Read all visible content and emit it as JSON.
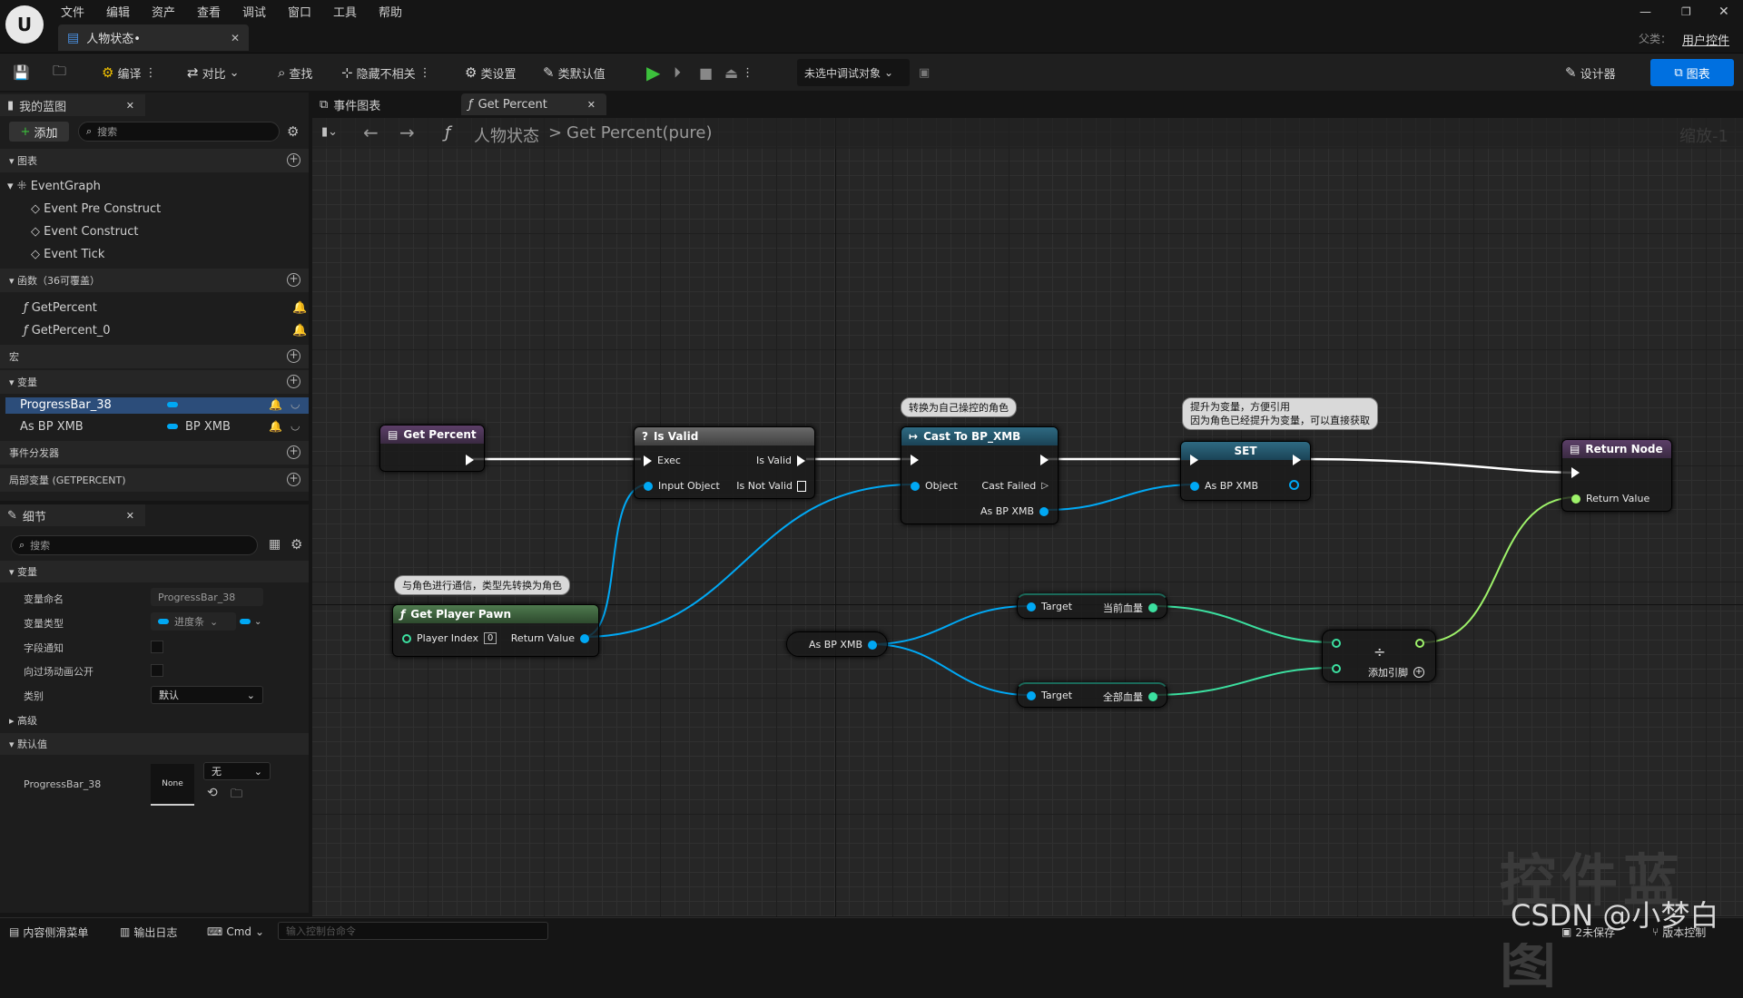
{
  "window": {
    "tab_title": "人物状态•",
    "parent_label": "父类：",
    "parent_value": "用户控件"
  },
  "menu": [
    "文件",
    "编辑",
    "资产",
    "查看",
    "调试",
    "窗口",
    "工具",
    "帮助"
  ],
  "toolbar": {
    "compile": "编译",
    "diff": "对比",
    "find": "查找",
    "hide_unrelated": "隐藏不相关",
    "class_settings": "类设置",
    "class_defaults": "类默认值",
    "debug_target": "未选中调试对象",
    "designer": "设计器",
    "graph": "图表"
  },
  "my_blueprint": {
    "tab": "我的蓝图",
    "add": "添加",
    "search_placeholder": "搜索",
    "graphs_header": "图表",
    "event_graph": "EventGraph",
    "events": [
      "Event Pre Construct",
      "Event Construct",
      "Event Tick"
    ],
    "functions_header": "函数（36可覆盖）",
    "functions": [
      "GetPercent",
      "GetPercent_0"
    ],
    "macros_header": "宏",
    "variables_header": "变量",
    "variables": [
      {
        "name": "ProgressBar_38",
        "type": ""
      },
      {
        "name": "As BP XMB",
        "type": "BP XMB"
      }
    ],
    "dispatchers_header": "事件分发器",
    "locals_header": "局部变量 (GETPERCENT)"
  },
  "details": {
    "tab": "细节",
    "search_placeholder": "搜索",
    "section_variable": "变量",
    "var_name_label": "变量命名",
    "var_name_value": "ProgressBar_38",
    "var_type_label": "变量类型",
    "var_type_value": "进度条",
    "field_notify_label": "字段通知",
    "expose_anim_label": "向过场动画公开",
    "category_label": "类别",
    "category_value": "默认",
    "advanced": "高级",
    "defaults_header": "默认值",
    "default_var": "ProgressBar_38",
    "default_thumb": "None",
    "default_select": "无"
  },
  "graph": {
    "tabs": [
      "事件图表",
      "Get Percent"
    ],
    "breadcrumb_root": "人物状态",
    "breadcrumb_sep": ">",
    "breadcrumb_leaf": "Get Percent(pure)",
    "zoom": "缩放-1",
    "watermark": "控件蓝图",
    "nodes": {
      "get_percent": "Get Percent",
      "is_valid": {
        "title": "Is Valid",
        "exec": "Exec",
        "input": "Input Object",
        "valid": "Is Valid",
        "not_valid": "Is Not Valid"
      },
      "cast": {
        "title": "Cast To BP_XMB",
        "object": "Object",
        "failed": "Cast Failed",
        "as": "As BP XMB"
      },
      "set": {
        "title": "SET",
        "as": "As BP XMB"
      },
      "return": {
        "title": "Return Node",
        "value": "Return Value"
      },
      "pawn": {
        "title": "Get Player Pawn",
        "index": "Player Index",
        "index_val": "0",
        "ret": "Return Value"
      },
      "var_get": "As BP XMB",
      "cur_hp": {
        "target": "Target",
        "out": "当前血量"
      },
      "max_hp": {
        "target": "Target",
        "out": "全部血量"
      },
      "divide": {
        "symbol": "÷",
        "add_pin": "添加引脚"
      }
    },
    "comments": {
      "cast": "转换为自己操控的角色",
      "set_line1": "提升为变量，方便引用",
      "set_line2": "因为角色已经提升为变量，可以直接获取",
      "pawn": "与角色进行通信，类型先转换为角色"
    }
  },
  "status": {
    "content_drawer": "内容侧滑菜单",
    "output_log": "输出日志",
    "cmd": "Cmd",
    "console_placeholder": "输入控制台命令",
    "unsaved": "2未保存",
    "source_control": "版本控制",
    "csdn": "CSDN @小梦白"
  },
  "colors": {
    "accent": "#0070e0",
    "object_pin": "#00a8f4",
    "float_pin": "#9ef26a",
    "exec_header": "#4b3e52"
  }
}
